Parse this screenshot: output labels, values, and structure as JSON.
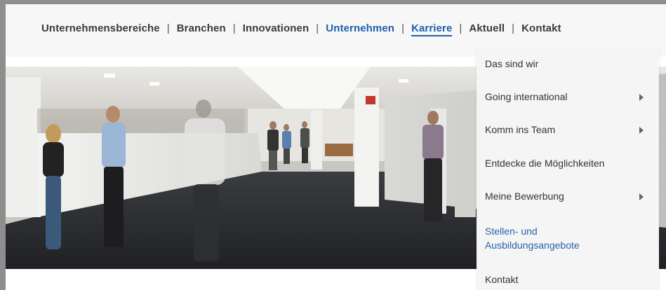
{
  "topnav": {
    "items": [
      {
        "label": "Unternehmensbereiche"
      },
      {
        "label": "Branchen"
      },
      {
        "label": "Innovationen"
      },
      {
        "label": "Unternehmen"
      },
      {
        "label": "Karriere"
      },
      {
        "label": "Aktuell"
      },
      {
        "label": "Kontakt"
      }
    ],
    "separator": "|"
  },
  "dropdown": {
    "items": [
      {
        "label": "Das sind wir",
        "has_submenu": false
      },
      {
        "label": "Going international",
        "has_submenu": true
      },
      {
        "label": "Komm ins Team",
        "has_submenu": true
      },
      {
        "label": "Entdecke die Möglichkeiten",
        "has_submenu": false
      },
      {
        "label": "Meine Bewerbung",
        "has_submenu": true
      },
      {
        "label_line1": "Stellen- und",
        "label_line2": "Ausbildungsangebote",
        "has_submenu": false,
        "highlighted": true
      },
      {
        "label": "Kontakt",
        "has_submenu": false
      }
    ]
  },
  "hero": {
    "exit_sign_icon": "emergency-exit-icon"
  },
  "colors": {
    "nav_text": "#3a3a3a",
    "nav_accent": "#1f5ea8",
    "dropdown_bg": "#f5f5f5"
  }
}
